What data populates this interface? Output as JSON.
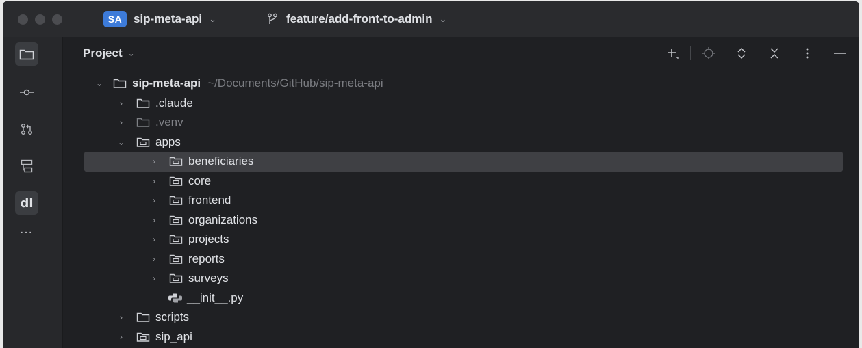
{
  "titlebar": {
    "project_badge": "SA",
    "project_name": "sip-meta-api",
    "branch_name": "feature/add-front-to-admin"
  },
  "toolstrip": {
    "items": [
      {
        "icon": "folder-icon",
        "active": true
      },
      {
        "icon": "commit-icon",
        "active": false
      },
      {
        "icon": "pull-request-icon",
        "active": false
      },
      {
        "icon": "structure-icon",
        "active": false
      },
      {
        "icon": "di-icon",
        "label": "di",
        "active": true
      },
      {
        "icon": "more-icon",
        "label": "…",
        "active": false
      }
    ]
  },
  "panel": {
    "title": "Project",
    "actions": [
      "add-icon",
      "locate-icon",
      "expand-icon",
      "collapse-icon",
      "more-vertical-icon",
      "minimize-icon"
    ]
  },
  "tree": {
    "root": {
      "name": "sip-meta-api",
      "path": "~/Documents/GitHub/sip-meta-api"
    },
    "items": [
      {
        "name": ".claude",
        "kind": "folder",
        "level": 1,
        "expanded": false
      },
      {
        "name": ".venv",
        "kind": "folder",
        "level": 1,
        "expanded": false,
        "dim": true
      },
      {
        "name": "apps",
        "kind": "package",
        "level": 1,
        "expanded": true
      },
      {
        "name": "beneficiaries",
        "kind": "package",
        "level": 2,
        "expanded": false,
        "selected": true
      },
      {
        "name": "core",
        "kind": "package",
        "level": 2,
        "expanded": false
      },
      {
        "name": "frontend",
        "kind": "package",
        "level": 2,
        "expanded": false
      },
      {
        "name": "organizations",
        "kind": "package",
        "level": 2,
        "expanded": false
      },
      {
        "name": "projects",
        "kind": "package",
        "level": 2,
        "expanded": false
      },
      {
        "name": "reports",
        "kind": "package",
        "level": 2,
        "expanded": false
      },
      {
        "name": "surveys",
        "kind": "package",
        "level": 2,
        "expanded": false
      },
      {
        "name": "__init__.py",
        "kind": "python-file",
        "level": 2
      },
      {
        "name": "scripts",
        "kind": "folder",
        "level": 1,
        "expanded": false
      },
      {
        "name": "sip_api",
        "kind": "package",
        "level": 1,
        "expanded": false
      }
    ]
  },
  "colors": {
    "background": "#1f2023",
    "titlebar": "#2a2b2e",
    "selection": "#3f4044",
    "text": "#dfe1e5",
    "muted_text": "#7a7c81",
    "badge": "#3d7bd9"
  }
}
